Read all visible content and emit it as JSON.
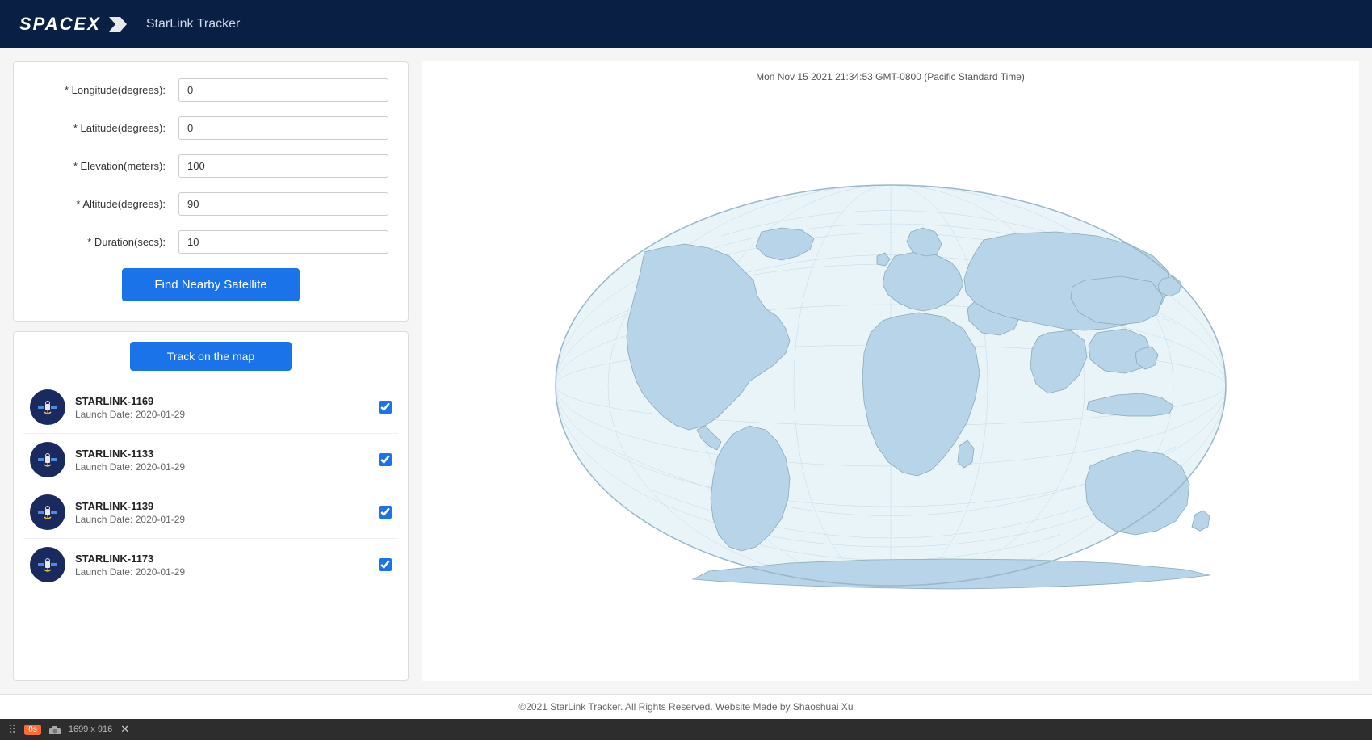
{
  "header": {
    "brand": "SPACEX",
    "title": "StarLink Tracker"
  },
  "form": {
    "longitude_label": "* Longitude(degrees):",
    "longitude_value": "0",
    "latitude_label": "* Latitude(degrees):",
    "latitude_value": "0",
    "elevation_label": "* Elevation(meters):",
    "elevation_value": "100",
    "altitude_label": "* Altitude(degrees):",
    "altitude_value": "90",
    "duration_label": "* Duration(secs):",
    "duration_value": "10",
    "find_button": "Find Nearby Satellite",
    "track_button": "Track on the map"
  },
  "map": {
    "timestamp": "Mon Nov 15 2021 21:34:53 GMT-0800 (Pacific Standard Time)"
  },
  "satellites": [
    {
      "name": "STARLINK-1169",
      "launch_date": "Launch Date: 2020-01-29",
      "checked": true
    },
    {
      "name": "STARLINK-1133",
      "launch_date": "Launch Date: 2020-01-29",
      "checked": true
    },
    {
      "name": "STARLINK-1139",
      "launch_date": "Launch Date: 2020-01-29",
      "checked": true
    },
    {
      "name": "STARLINK-1173",
      "launch_date": "Launch Date: 2020-01-29",
      "checked": true
    }
  ],
  "footer": {
    "text": "©2021 StarLink Tracker. All Rights Reserved. Website Made by Shaoshuai Xu"
  },
  "bottom_bar": {
    "timer": "0s",
    "dimensions": "1699 x 916"
  }
}
